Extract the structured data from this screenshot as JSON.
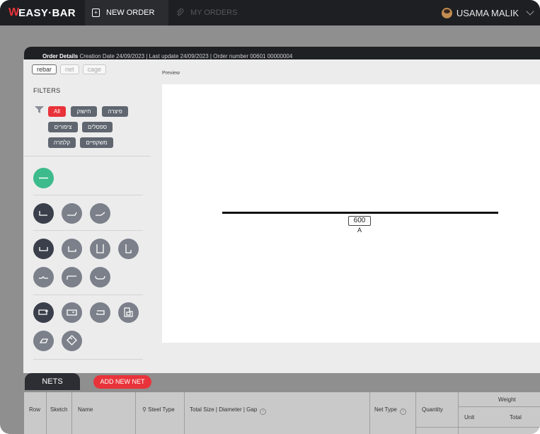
{
  "app": {
    "logo_mark": "W",
    "logo_text": "EASY·BAR"
  },
  "topbar": {
    "new_order": "NEW ORDER",
    "my_orders": "MY ORDERS",
    "user_name": "USAMA MALIK"
  },
  "order": {
    "details_label": "Order Details",
    "details_text": " Creation Date 24/09/2023 | Last update 24/09/2023 | Order number 00601 00000004"
  },
  "type_tabs": [
    "rebar",
    "net",
    "cage"
  ],
  "filters": {
    "title": "FILTERS",
    "chips": [
      "All",
      "חישוק",
      "פיצרה",
      "ציפורים",
      "ספסלים",
      "קלמרה",
      "משקפיים"
    ]
  },
  "preview": {
    "label": "Preview",
    "dimension_value": "600",
    "dimension_letter": "A"
  },
  "nets": {
    "tab_label": "NETS",
    "add_button": "ADD NEW NET",
    "columns": {
      "row": "Row",
      "sketch": "Sketch",
      "name": "Name",
      "steel_type": "Steel Type",
      "total_size": "Total Size | Diameter | Gap",
      "net_type": "Net Type",
      "quantity": "Quantity",
      "weight": "Weight",
      "unit": "Unit",
      "total": "Total"
    }
  },
  "colors": {
    "accent_red": "#e8333a",
    "shape_green": "#3dbb8c",
    "shape_dark": "#3a3f4b",
    "shape_gray": "#7b808a",
    "topbar_bg": "#1e1f22"
  }
}
